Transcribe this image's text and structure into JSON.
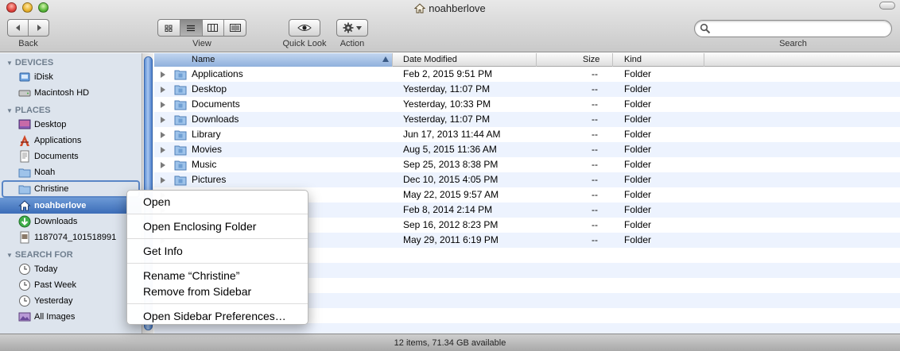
{
  "window": {
    "title": "noahberlove"
  },
  "toolbar": {
    "back_label": "Back",
    "view_label": "View",
    "quicklook_label": "Quick Look",
    "action_label": "Action",
    "search_label": "Search",
    "search_value": ""
  },
  "sidebar": {
    "devices_heading": "DEVICES",
    "devices": [
      {
        "label": "iDisk",
        "icon": "idisk-icon"
      },
      {
        "label": "Macintosh HD",
        "icon": "hard-drive-icon"
      }
    ],
    "places_heading": "PLACES",
    "places": [
      {
        "label": "Desktop",
        "icon": "desktop-folder-icon"
      },
      {
        "label": "Applications",
        "icon": "applications-icon"
      },
      {
        "label": "Documents",
        "icon": "documents-icon"
      },
      {
        "label": "Noah",
        "icon": "folder-icon"
      },
      {
        "label": "Christine",
        "icon": "folder-icon"
      },
      {
        "label": "noahberlove",
        "icon": "home-icon"
      },
      {
        "label": "Downloads",
        "icon": "downloads-icon"
      },
      {
        "label": "1187074_101518991",
        "icon": "file-icon"
      }
    ],
    "search_heading": "SEARCH FOR",
    "searches": [
      {
        "label": "Today",
        "icon": "clock-icon"
      },
      {
        "label": "Past Week",
        "icon": "clock-icon"
      },
      {
        "label": "Yesterday",
        "icon": "clock-icon"
      },
      {
        "label": "All Images",
        "icon": "images-icon"
      }
    ]
  },
  "columns": {
    "name": "Name",
    "date": "Date Modified",
    "size": "Size",
    "kind": "Kind"
  },
  "files": [
    {
      "name": "Applications",
      "date": "Feb 2, 2015 9:51 PM",
      "size": "--",
      "kind": "Folder"
    },
    {
      "name": "Desktop",
      "date": "Yesterday, 11:07 PM",
      "size": "--",
      "kind": "Folder"
    },
    {
      "name": "Documents",
      "date": "Yesterday, 10:33 PM",
      "size": "--",
      "kind": "Folder"
    },
    {
      "name": "Downloads",
      "date": "Yesterday, 11:07 PM",
      "size": "--",
      "kind": "Folder"
    },
    {
      "name": "Library",
      "date": "Jun 17, 2013 11:44 AM",
      "size": "--",
      "kind": "Folder"
    },
    {
      "name": "Movies",
      "date": "Aug 5, 2015 11:36 AM",
      "size": "--",
      "kind": "Folder"
    },
    {
      "name": "Music",
      "date": "Sep 25, 2013 8:38 PM",
      "size": "--",
      "kind": "Folder"
    },
    {
      "name": "Pictures",
      "date": "Dec 10, 2015 4:05 PM",
      "size": "--",
      "kind": "Folder"
    },
    {
      "name": "",
      "date": "May 22, 2015 9:57 AM",
      "size": "--",
      "kind": "Folder"
    },
    {
      "name": "",
      "date": "Feb 8, 2014 2:14 PM",
      "size": "--",
      "kind": "Folder"
    },
    {
      "name": "",
      "date": "Sep 16, 2012 8:23 PM",
      "size": "--",
      "kind": "Folder"
    },
    {
      "name": "",
      "date": "May 29, 2011 6:19 PM",
      "size": "--",
      "kind": "Folder"
    }
  ],
  "status": {
    "text": "12 items, 71.34 GB available"
  },
  "context_menu": {
    "open": "Open",
    "open_enclosing": "Open Enclosing Folder",
    "get_info": "Get Info",
    "rename": "Rename “Christine”",
    "remove": "Remove from Sidebar",
    "prefs": "Open Sidebar Preferences…"
  }
}
